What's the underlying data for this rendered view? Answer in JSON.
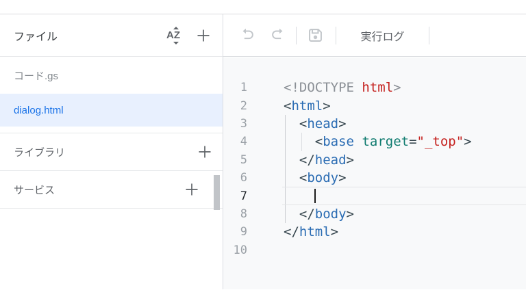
{
  "sidebar": {
    "title": "ファイル",
    "files": [
      {
        "name": "コード.gs",
        "selected": false
      },
      {
        "name": "dialog.html",
        "selected": true
      }
    ],
    "libraries_label": "ライブラリ",
    "services_label": "サービス",
    "selected_file_bg": "#e8f0fe",
    "selected_file_color": "#1a73e8"
  },
  "toolbar": {
    "run_log_label": "実行ログ",
    "disabled_icon_color": "#c3c7cb"
  },
  "editor": {
    "file_shown": "dialog.html",
    "active_line": 7,
    "cursor": {
      "line": 7,
      "column": 5
    },
    "background": "#f8f9fa",
    "syntax_colors": {
      "plain": "#202124",
      "gray": "#8b9096",
      "red": "#c5221f",
      "delim": "#37474f",
      "tag": "#2a6cb3",
      "attr": "#0f7b6f",
      "string": "#c5221f"
    },
    "lines": [
      {
        "num": "1",
        "tokens": [
          {
            "t": "<!DOCTYPE ",
            "c": "gray"
          },
          {
            "t": "html",
            "c": "red"
          },
          {
            "t": ">",
            "c": "gray"
          }
        ]
      },
      {
        "num": "2",
        "tokens": [
          {
            "t": "<",
            "c": "delim"
          },
          {
            "t": "html",
            "c": "tag"
          },
          {
            "t": ">",
            "c": "delim"
          }
        ]
      },
      {
        "num": "3",
        "tokens": [
          {
            "t": "  ",
            "c": "plain"
          },
          {
            "t": "<",
            "c": "delim"
          },
          {
            "t": "head",
            "c": "tag"
          },
          {
            "t": ">",
            "c": "delim"
          }
        ]
      },
      {
        "num": "4",
        "tokens": [
          {
            "t": "    ",
            "c": "plain"
          },
          {
            "t": "<",
            "c": "delim"
          },
          {
            "t": "base",
            "c": "tag"
          },
          {
            "t": " ",
            "c": "plain"
          },
          {
            "t": "target",
            "c": "attr"
          },
          {
            "t": "=",
            "c": "delim"
          },
          {
            "t": "\"_top\"",
            "c": "string"
          },
          {
            "t": ">",
            "c": "delim"
          }
        ]
      },
      {
        "num": "5",
        "tokens": [
          {
            "t": "  ",
            "c": "plain"
          },
          {
            "t": "</",
            "c": "delim"
          },
          {
            "t": "head",
            "c": "tag"
          },
          {
            "t": ">",
            "c": "delim"
          }
        ]
      },
      {
        "num": "6",
        "tokens": [
          {
            "t": "  ",
            "c": "plain"
          },
          {
            "t": "<",
            "c": "delim"
          },
          {
            "t": "body",
            "c": "tag"
          },
          {
            "t": ">",
            "c": "delim"
          }
        ]
      },
      {
        "num": "7",
        "tokens": [
          {
            "t": "    ",
            "c": "plain"
          }
        ]
      },
      {
        "num": "8",
        "tokens": [
          {
            "t": "  ",
            "c": "plain"
          },
          {
            "t": "</",
            "c": "delim"
          },
          {
            "t": "body",
            "c": "tag"
          },
          {
            "t": ">",
            "c": "delim"
          }
        ]
      },
      {
        "num": "9",
        "tokens": [
          {
            "t": "</",
            "c": "delim"
          },
          {
            "t": "html",
            "c": "tag"
          },
          {
            "t": ">",
            "c": "delim"
          }
        ]
      },
      {
        "num": "10",
        "tokens": []
      }
    ]
  }
}
